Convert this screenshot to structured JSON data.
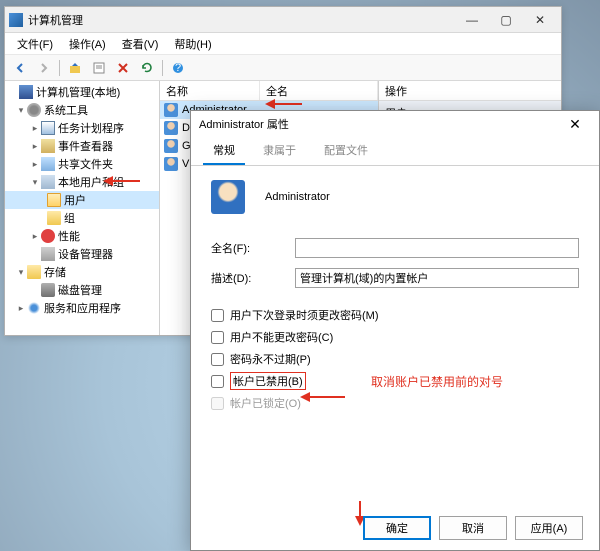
{
  "mainWindow": {
    "title": "计算机管理",
    "menus": [
      "文件(F)",
      "操作(A)",
      "查看(V)",
      "帮助(H)"
    ],
    "tree": {
      "root": "计算机管理(本地)",
      "items": [
        {
          "label": "系统工具",
          "children": [
            {
              "label": "任务计划程序"
            },
            {
              "label": "事件查看器"
            },
            {
              "label": "共享文件夹"
            },
            {
              "label": "本地用户和组",
              "children": [
                {
                  "label": "用户",
                  "selected": true
                },
                {
                  "label": "组"
                }
              ]
            },
            {
              "label": "性能"
            },
            {
              "label": "设备管理器"
            }
          ]
        },
        {
          "label": "存储",
          "children": [
            {
              "label": "磁盘管理"
            }
          ]
        },
        {
          "label": "服务和应用程序"
        }
      ]
    },
    "list": {
      "cols": [
        "名称",
        "全名"
      ],
      "rows": [
        "Administrator",
        "D",
        "G",
        "V"
      ]
    },
    "actions": {
      "header": "操作",
      "section": "用户"
    }
  },
  "dialog": {
    "title": "Administrator 属性",
    "tabs": [
      "常规",
      "隶属于",
      "配置文件"
    ],
    "user": "Administrator",
    "fullNameLabel": "全名(F):",
    "fullNameValue": "",
    "descLabel": "描述(D):",
    "descValue": "管理计算机(域)的内置帐户",
    "checks": [
      "用户下次登录时须更改密码(M)",
      "用户不能更改密码(C)",
      "密码永不过期(P)",
      "帐户已禁用(B)",
      "帐户已锁定(O)"
    ],
    "annotation": "取消账户已禁用前的对号",
    "buttons": {
      "ok": "确定",
      "cancel": "取消",
      "apply": "应用(A)"
    }
  }
}
